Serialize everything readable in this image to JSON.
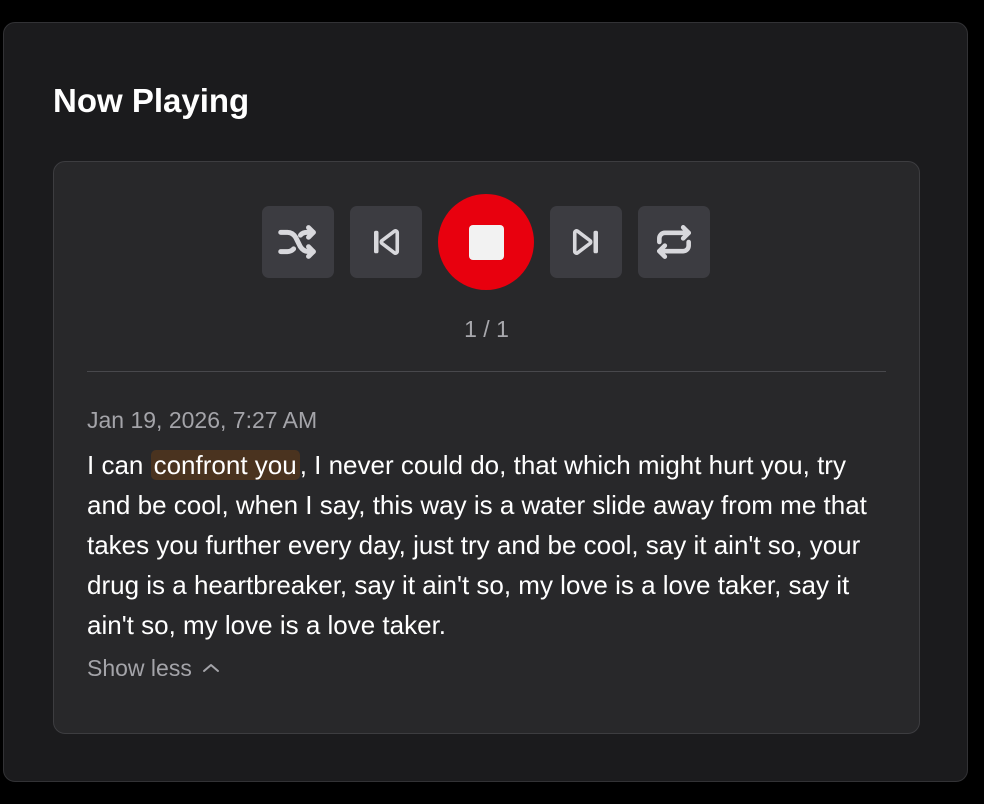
{
  "panel": {
    "title": "Now Playing"
  },
  "player": {
    "controls": {
      "shuffle_icon": "shuffle-icon",
      "previous_icon": "skip-previous-icon",
      "stop_icon": "stop-icon",
      "next_icon": "skip-next-icon",
      "repeat_icon": "repeat-icon",
      "stop_color": "#e8000e"
    },
    "track_counter": "1 / 1"
  },
  "entry": {
    "timestamp": "Jan 19, 2026, 7:27 AM",
    "lyrics_before": "I can ",
    "lyrics_highlight": "confront you",
    "lyrics_after": ", I never could do, that which might hurt you, try and be cool, when I say, this way is a water slide away from me that takes you further every day, just try and be cool, say it ain't so, your drug is a heartbreaker, say it ain't so, my love is a love taker, say it ain't so, my love is a love taker.",
    "highlight_color": "#4a331f",
    "toggle_label": "Show less",
    "toggle_icon": "chevron-up-icon"
  }
}
